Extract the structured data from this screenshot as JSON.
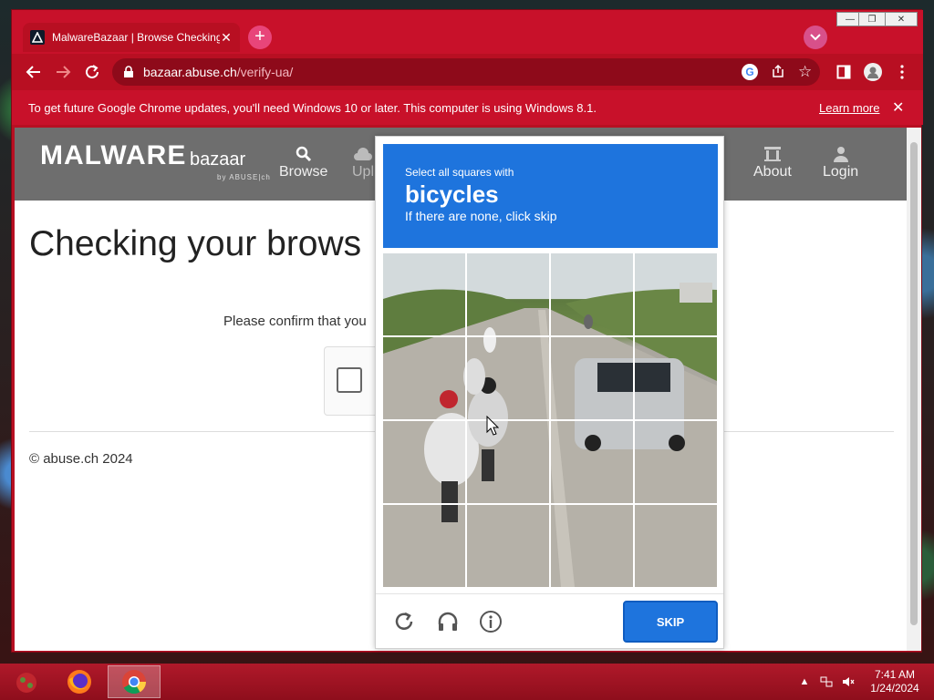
{
  "browser": {
    "tab": {
      "title": "MalwareBazaar | Browse Checking",
      "close": "✕",
      "favicon_icon": "malwarebazaar-favicon"
    },
    "new_tab": "+",
    "address": {
      "host": "bazaar.abuse.ch",
      "path": "/verify-ua/"
    },
    "window_controls": {
      "minimize": "—",
      "maximize": "❐",
      "close": "✕"
    },
    "infobar": {
      "message": "To get future Google Chrome updates, you'll need Windows 10 or later. This computer is using Windows 8.1.",
      "link": "Learn more",
      "close": "✕"
    }
  },
  "site": {
    "logo_main": "MALWARE",
    "logo_sub": "bazaar",
    "logo_by": "by ABUSE|ch",
    "nav": {
      "browse": "Browse",
      "upload": "Upl",
      "about": "About",
      "login": "Login"
    },
    "page_title": "Checking your brows",
    "confirm_text": "Please confirm that you",
    "copyright": "© abuse.ch 2024"
  },
  "captcha": {
    "instruction": "Select all squares with",
    "target": "bicycles",
    "hint": "If there are none, click skip",
    "skip_label": "SKIP",
    "grid_cells": 16
  },
  "taskbar": {
    "time": "7:41 AM",
    "date": "1/24/2024"
  },
  "colors": {
    "browser_frame": "#b80f22",
    "captcha_blue": "#1e74dd",
    "site_nav": "#6e6e6e"
  }
}
